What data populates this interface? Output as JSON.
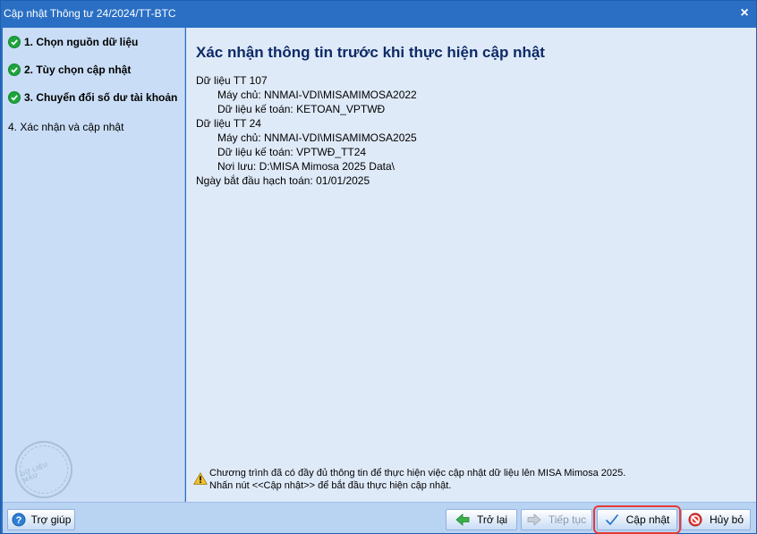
{
  "window": {
    "title": "Cập nhật Thông tư 24/2024/TT-BTC",
    "close_glyph": "×"
  },
  "sidebar": {
    "steps": [
      {
        "label": "1. Chọn nguồn dữ liệu",
        "status": "done"
      },
      {
        "label": "2. Tùy chọn cập nhật",
        "status": "done"
      },
      {
        "label": "3. Chuyển đổi số dư tài khoản",
        "status": "done"
      },
      {
        "label": "4. Xác nhận và cập nhật",
        "status": "current"
      }
    ],
    "stamp_text": "DỮ LIỆU MẪU"
  },
  "main": {
    "heading": "Xác nhận thông tin trước khi thực hiện cập nhật",
    "lines": [
      "Dữ liệu TT 107",
      "Máy chủ: NNMAI-VDI\\MISAMIMOSA2022",
      "Dữ liệu kế toán:  KETOAN_VPTWĐ",
      "Dữ liệu TT 24",
      "Máy chủ: NNMAI-VDI\\MISAMIMOSA2025",
      "Dữ liệu kế toán:  VPTWĐ_TT24",
      "Nơi lưu:  D:\\MISA Mimosa 2025 Data\\",
      "Ngày bắt đầu hạch toán: 01/01/2025"
    ],
    "notice": {
      "line1": "Chương trình đã có đầy đủ thông tin để thực hiện việc cập nhật dữ liệu lên MISA Mimosa 2025.",
      "line2": "Nhấn nút <<Cập nhật>> để bắt đầu thực hiện cập nhật."
    }
  },
  "footer": {
    "help": "Trợ giúp",
    "back": "Trở lại",
    "next": "Tiếp tục",
    "update": "Cập nhật",
    "cancel": "Hủy bỏ"
  },
  "colors": {
    "title_bar": "#2a6fc4",
    "sidebar_bg": "#c9ddf6",
    "content_bg": "#dfeaf9",
    "footer_bg": "#b9d3f3",
    "check_green": "#1fa33d",
    "highlight_red": "#e53935"
  }
}
